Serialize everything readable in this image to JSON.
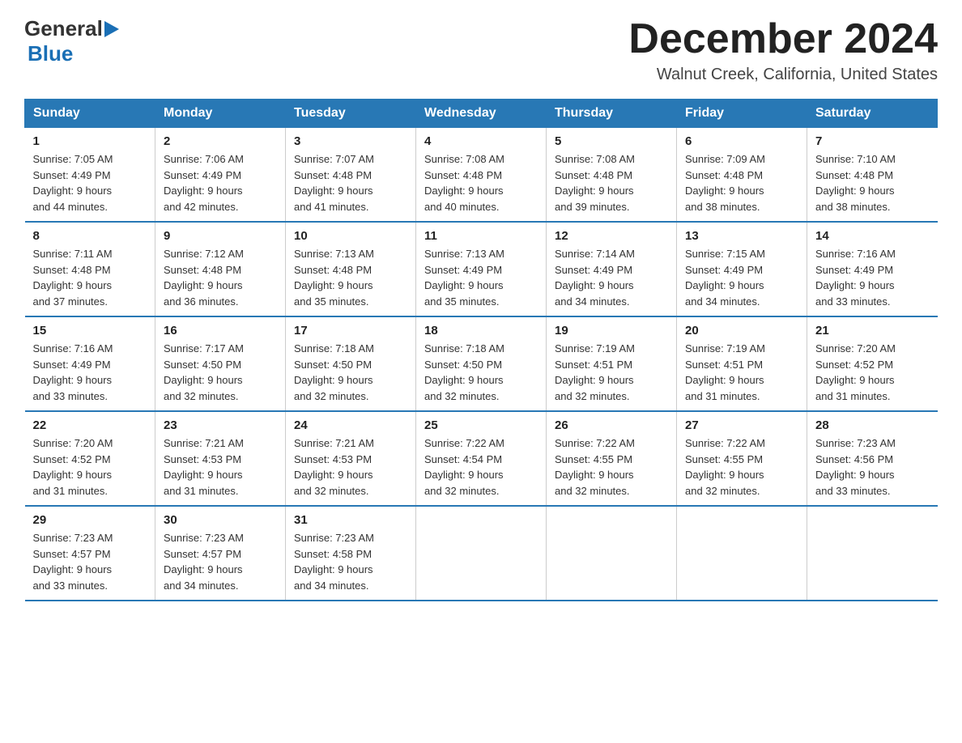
{
  "header": {
    "title": "December 2024",
    "subtitle": "Walnut Creek, California, United States",
    "logo_general": "General",
    "logo_blue": "Blue"
  },
  "weekdays": [
    "Sunday",
    "Monday",
    "Tuesday",
    "Wednesday",
    "Thursday",
    "Friday",
    "Saturday"
  ],
  "weeks": [
    [
      {
        "day": "1",
        "info": "Sunrise: 7:05 AM\nSunset: 4:49 PM\nDaylight: 9 hours\nand 44 minutes."
      },
      {
        "day": "2",
        "info": "Sunrise: 7:06 AM\nSunset: 4:49 PM\nDaylight: 9 hours\nand 42 minutes."
      },
      {
        "day": "3",
        "info": "Sunrise: 7:07 AM\nSunset: 4:48 PM\nDaylight: 9 hours\nand 41 minutes."
      },
      {
        "day": "4",
        "info": "Sunrise: 7:08 AM\nSunset: 4:48 PM\nDaylight: 9 hours\nand 40 minutes."
      },
      {
        "day": "5",
        "info": "Sunrise: 7:08 AM\nSunset: 4:48 PM\nDaylight: 9 hours\nand 39 minutes."
      },
      {
        "day": "6",
        "info": "Sunrise: 7:09 AM\nSunset: 4:48 PM\nDaylight: 9 hours\nand 38 minutes."
      },
      {
        "day": "7",
        "info": "Sunrise: 7:10 AM\nSunset: 4:48 PM\nDaylight: 9 hours\nand 38 minutes."
      }
    ],
    [
      {
        "day": "8",
        "info": "Sunrise: 7:11 AM\nSunset: 4:48 PM\nDaylight: 9 hours\nand 37 minutes."
      },
      {
        "day": "9",
        "info": "Sunrise: 7:12 AM\nSunset: 4:48 PM\nDaylight: 9 hours\nand 36 minutes."
      },
      {
        "day": "10",
        "info": "Sunrise: 7:13 AM\nSunset: 4:48 PM\nDaylight: 9 hours\nand 35 minutes."
      },
      {
        "day": "11",
        "info": "Sunrise: 7:13 AM\nSunset: 4:49 PM\nDaylight: 9 hours\nand 35 minutes."
      },
      {
        "day": "12",
        "info": "Sunrise: 7:14 AM\nSunset: 4:49 PM\nDaylight: 9 hours\nand 34 minutes."
      },
      {
        "day": "13",
        "info": "Sunrise: 7:15 AM\nSunset: 4:49 PM\nDaylight: 9 hours\nand 34 minutes."
      },
      {
        "day": "14",
        "info": "Sunrise: 7:16 AM\nSunset: 4:49 PM\nDaylight: 9 hours\nand 33 minutes."
      }
    ],
    [
      {
        "day": "15",
        "info": "Sunrise: 7:16 AM\nSunset: 4:49 PM\nDaylight: 9 hours\nand 33 minutes."
      },
      {
        "day": "16",
        "info": "Sunrise: 7:17 AM\nSunset: 4:50 PM\nDaylight: 9 hours\nand 32 minutes."
      },
      {
        "day": "17",
        "info": "Sunrise: 7:18 AM\nSunset: 4:50 PM\nDaylight: 9 hours\nand 32 minutes."
      },
      {
        "day": "18",
        "info": "Sunrise: 7:18 AM\nSunset: 4:50 PM\nDaylight: 9 hours\nand 32 minutes."
      },
      {
        "day": "19",
        "info": "Sunrise: 7:19 AM\nSunset: 4:51 PM\nDaylight: 9 hours\nand 32 minutes."
      },
      {
        "day": "20",
        "info": "Sunrise: 7:19 AM\nSunset: 4:51 PM\nDaylight: 9 hours\nand 31 minutes."
      },
      {
        "day": "21",
        "info": "Sunrise: 7:20 AM\nSunset: 4:52 PM\nDaylight: 9 hours\nand 31 minutes."
      }
    ],
    [
      {
        "day": "22",
        "info": "Sunrise: 7:20 AM\nSunset: 4:52 PM\nDaylight: 9 hours\nand 31 minutes."
      },
      {
        "day": "23",
        "info": "Sunrise: 7:21 AM\nSunset: 4:53 PM\nDaylight: 9 hours\nand 31 minutes."
      },
      {
        "day": "24",
        "info": "Sunrise: 7:21 AM\nSunset: 4:53 PM\nDaylight: 9 hours\nand 32 minutes."
      },
      {
        "day": "25",
        "info": "Sunrise: 7:22 AM\nSunset: 4:54 PM\nDaylight: 9 hours\nand 32 minutes."
      },
      {
        "day": "26",
        "info": "Sunrise: 7:22 AM\nSunset: 4:55 PM\nDaylight: 9 hours\nand 32 minutes."
      },
      {
        "day": "27",
        "info": "Sunrise: 7:22 AM\nSunset: 4:55 PM\nDaylight: 9 hours\nand 32 minutes."
      },
      {
        "day": "28",
        "info": "Sunrise: 7:23 AM\nSunset: 4:56 PM\nDaylight: 9 hours\nand 33 minutes."
      }
    ],
    [
      {
        "day": "29",
        "info": "Sunrise: 7:23 AM\nSunset: 4:57 PM\nDaylight: 9 hours\nand 33 minutes."
      },
      {
        "day": "30",
        "info": "Sunrise: 7:23 AM\nSunset: 4:57 PM\nDaylight: 9 hours\nand 34 minutes."
      },
      {
        "day": "31",
        "info": "Sunrise: 7:23 AM\nSunset: 4:58 PM\nDaylight: 9 hours\nand 34 minutes."
      },
      {
        "day": "",
        "info": ""
      },
      {
        "day": "",
        "info": ""
      },
      {
        "day": "",
        "info": ""
      },
      {
        "day": "",
        "info": ""
      }
    ]
  ]
}
